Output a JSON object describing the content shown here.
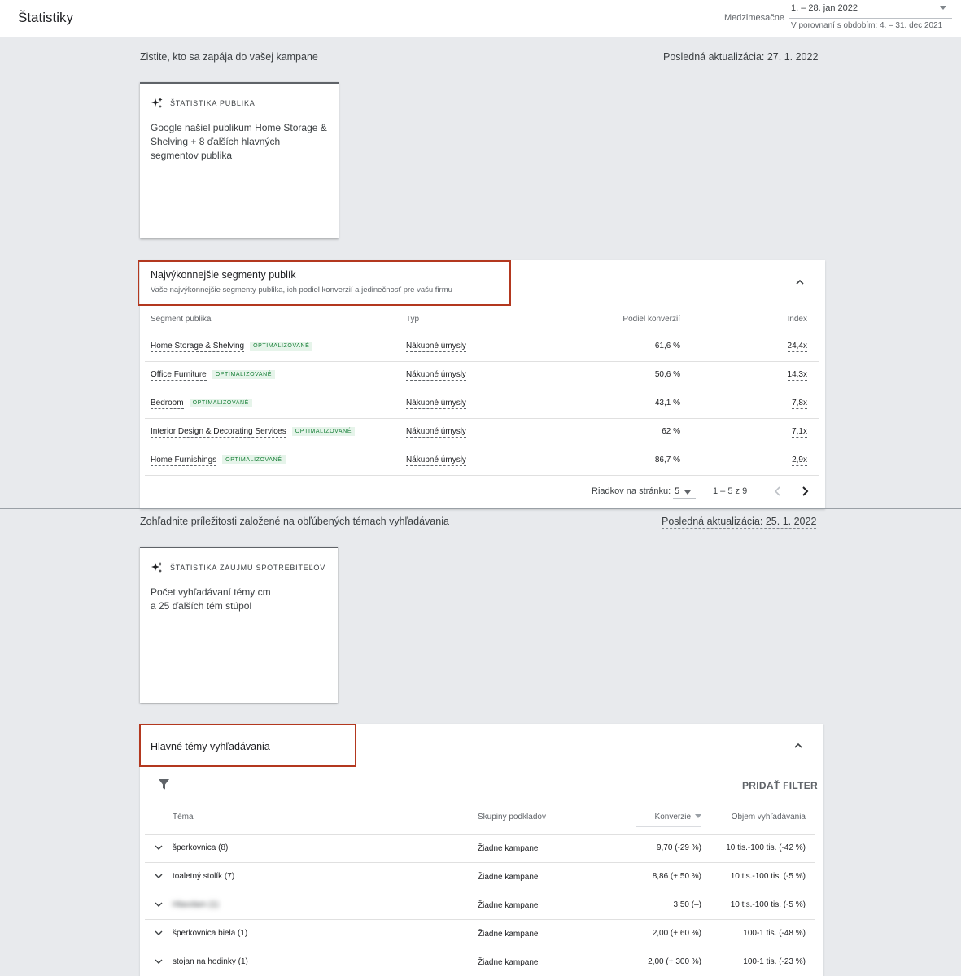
{
  "header": {
    "title": "Štatistiky",
    "period_label": "Medzimesačne",
    "date_range": "1. – 28. jan 2022",
    "compare_range": "V porovnaní s obdobím: 4. – 31. dec 2021"
  },
  "section1": {
    "heading": "Zistite, kto sa zapája do vašej kampane",
    "updated": "Posledná aktualizácia: 27. 1. 2022"
  },
  "audience_card": {
    "kicker": "ŠTATISTIKA PUBLIKA",
    "body": "Google našiel publikum Home Storage & Shelving + 8 ďalších hlavných segmentov publika"
  },
  "segments_panel": {
    "title": "Najvýkonnejšie segmenty publík",
    "subtitle": "Vaše najvýkonnejšie segmenty publika, ich podiel konverzií a jedinečnosť pre vašu firmu",
    "columns": [
      "Segment publika",
      "Typ",
      "Podiel konverzií",
      "Index"
    ],
    "badge": "OPTIMALIZOVANÉ",
    "rows": [
      {
        "segment": "Home Storage & Shelving",
        "type": "Nákupné úmysly",
        "share": "61,6 %",
        "index": "24,4x"
      },
      {
        "segment": "Office Furniture",
        "type": "Nákupné úmysly",
        "share": "50,6 %",
        "index": "14,3x"
      },
      {
        "segment": "Bedroom",
        "type": "Nákupné úmysly",
        "share": "43,1 %",
        "index": "7,8x"
      },
      {
        "segment": "Interior Design & Decorating Services",
        "type": "Nákupné úmysly",
        "share": "62 %",
        "index": "7,1x"
      },
      {
        "segment": "Home Furnishings",
        "type": "Nákupné úmysly",
        "share": "86,7 %",
        "index": "2,9x"
      }
    ],
    "rows_per_page_label": "Riadkov na stránku:",
    "rows_per_page": "5",
    "range": "1 – 5 z 9"
  },
  "section2": {
    "heading": "Zohľadnite príležitosti založené na obľúbených témach vyhľadávania",
    "updated": "Posledná aktualizácia: 25. 1. 2022"
  },
  "interest_card": {
    "kicker": "ŠTATISTIKA ZÁUJMU SPOTREBITEĽOV",
    "body_line1": "Počet vyhľadávaní témy cm",
    "body_line2": "a 25 ďalších tém stúpol"
  },
  "topics_panel": {
    "title": "Hlavné témy vyhľadávania",
    "add_filter": "PRIDAŤ FILTER",
    "columns": [
      "Téma",
      "Skupiny podkladov",
      "Konverzie",
      "Objem vyhľadávania"
    ],
    "rows": [
      {
        "topic": "šperkovnica (8)",
        "group": "Žiadne kampane",
        "conv": "9,70 (-29 %)",
        "volume": "10 tis.-100 tis. (-42 %)"
      },
      {
        "topic": "toaletný stolík (7)",
        "group": "Žiadne kampane",
        "conv": "8,86 (+ 50 %)",
        "volume": "10 tis.-100 tis. (-5 %)"
      },
      {
        "topic": "Hlavolam (1)",
        "group": "Žiadne kampane",
        "conv": "3,50 (–)",
        "volume": "10 tis.-100 tis. (-5 %)"
      },
      {
        "topic": "šperkovnica biela (1)",
        "group": "Žiadne kampane",
        "conv": "2,00 (+ 60 %)",
        "volume": "100-1 tis. (-48 %)"
      },
      {
        "topic": "stojan na hodinky (1)",
        "group": "Žiadne kampane",
        "conv": "2,00 (+ 300 %)",
        "volume": "100-1 tis. (-23 %)"
      }
    ]
  },
  "icons": {
    "sparkle": "sparkle-icon",
    "filter": "filter-icon",
    "chevron_up": "chevron-up-icon",
    "chevron_down": "chevron-down-icon",
    "chevron_left": "chevron-left-icon",
    "chevron_right": "chevron-right-icon"
  },
  "colors": {
    "highlight_box": "#b3381f",
    "badge_bg": "#e6f4ea",
    "badge_text": "#188038",
    "background": "#e8eaed"
  }
}
